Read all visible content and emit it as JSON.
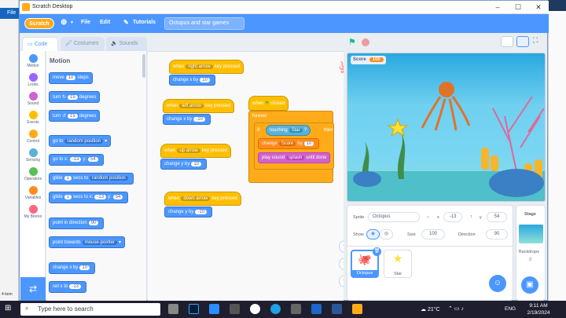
{
  "window": {
    "title": "Scratch Desktop"
  },
  "background": {
    "file_tab": "File",
    "status_items": "4 item"
  },
  "menubar": {
    "logo": "Scratch",
    "file": "File",
    "edit": "Edit",
    "tutorials": "Tutorials",
    "project_title": "Octopus and star games"
  },
  "tabs": {
    "code": "Code",
    "costumes": "Costumes",
    "sounds": "Sounds"
  },
  "categories": [
    {
      "label": "Motion",
      "color": "#4c97ff"
    },
    {
      "label": "Looks",
      "color": "#9966ff"
    },
    {
      "label": "Sound",
      "color": "#cf63cf"
    },
    {
      "label": "Events",
      "color": "#ffbf00"
    },
    {
      "label": "Control",
      "color": "#ffab19"
    },
    {
      "label": "Sensing",
      "color": "#5cb1d6"
    },
    {
      "label": "Operators",
      "color": "#59c059"
    },
    {
      "label": "Variables",
      "color": "#ff8c1a"
    },
    {
      "label": "My Blocks",
      "color": "#ff6680"
    }
  ],
  "palette": {
    "heading": "Motion",
    "move": {
      "a": "move",
      "v": "10",
      "b": "steps"
    },
    "turn_r": {
      "a": "turn",
      "v": "15",
      "b": "degrees"
    },
    "turn_l": {
      "a": "turn",
      "v": "15",
      "b": "degrees"
    },
    "goto": {
      "a": "go to",
      "v": "random position"
    },
    "gotoxy": {
      "a": "go to x:",
      "x": "-13",
      "b": "y:",
      "y": "54"
    },
    "glide1": {
      "a": "glide",
      "v": "1",
      "b": "secs to",
      "c": "random position"
    },
    "glide2": {
      "a": "glide",
      "v": "1",
      "b": "secs to x:",
      "x": "-13",
      "c": "y:",
      "y": "54"
    },
    "point": {
      "a": "point in direction",
      "v": "90"
    },
    "pointto": {
      "a": "point towards",
      "v": "mouse-pointer"
    },
    "changex": {
      "a": "change x by",
      "v": "10"
    },
    "setx": {
      "a": "set x to",
      "v": "-13"
    }
  },
  "scripts": {
    "right": {
      "when": "when",
      "key": "right arrow",
      "pressed": "key pressed",
      "action": "change x by",
      "val": "10"
    },
    "left": {
      "when": "when",
      "key": "left arrow",
      "pressed": "key pressed",
      "action": "change x by",
      "val": "-10"
    },
    "up": {
      "when": "when",
      "key": "up arrow",
      "pressed": "key pressed",
      "action": "change y by",
      "val": "10"
    },
    "down": {
      "when": "when",
      "key": "down arrow",
      "pressed": "key pressed",
      "action": "change y by",
      "val": "-10"
    },
    "flag": {
      "when": "when",
      "clicked": "clicked",
      "forever": "forever",
      "if": "if",
      "touching": "touching",
      "target": "Star",
      "q": "?",
      "then": "then",
      "change": "change",
      "effect": "Score",
      "by": "by",
      "by_val": "10",
      "play": "play sound",
      "sound": "splash",
      "until": "until done"
    }
  },
  "stage": {
    "score_label": "Score",
    "score_value": "100"
  },
  "sprite": {
    "sprite_label": "Sprite",
    "name": "Octopus",
    "x_label": "x",
    "x": "-13",
    "y_label": "y",
    "y": "54",
    "show_label": "Show",
    "size_label": "Size",
    "size": "100",
    "direction_label": "Direction",
    "direction": "90",
    "thumbs": [
      "Octopus",
      "Star"
    ]
  },
  "stagepane": {
    "title": "Stage",
    "backdrops_label": "Backdrops",
    "backdrops": "2"
  },
  "taskbar": {
    "search": "Type here to search",
    "weather": "21°C",
    "lang": "ENG",
    "time": "9:11 AM",
    "date": "2/19/2024"
  }
}
